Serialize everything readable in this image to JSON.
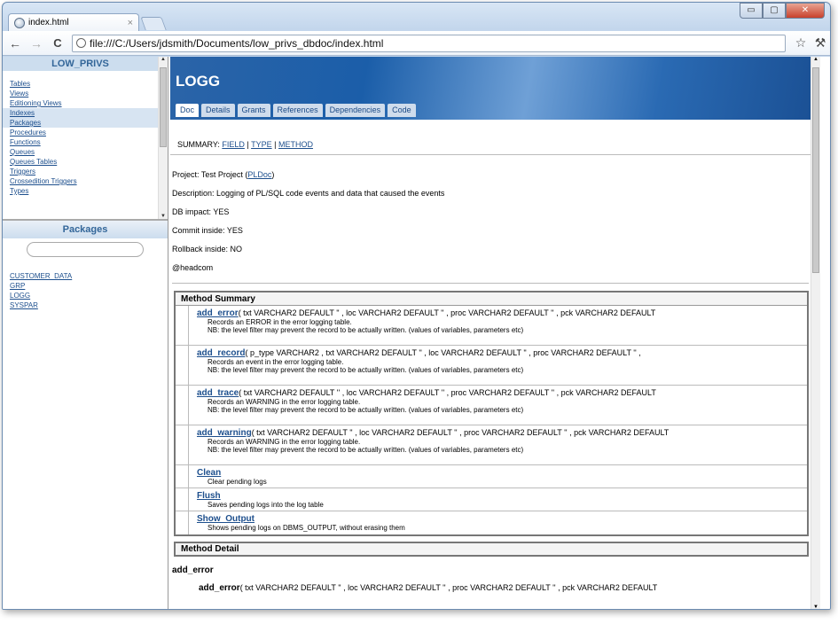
{
  "browser": {
    "tab_title": "index.html",
    "tab_close": "×",
    "url": "file:///C:/Users/jdsmith/Documents/low_privs_dbdoc/index.html",
    "back": "←",
    "forward": "→",
    "reload": "C",
    "star": "☆",
    "wrench": "🔧",
    "win_min": "▭",
    "win_max": "▢",
    "win_close": "✕"
  },
  "sidebar": {
    "title": "LOW_PRIVS",
    "items": [
      {
        "label": "Tables",
        "selected": false
      },
      {
        "label": "Views",
        "selected": false
      },
      {
        "label": "Editioning Views",
        "selected": false
      },
      {
        "label": "Indexes",
        "selected": true
      },
      {
        "label": "Packages",
        "selected": true
      },
      {
        "label": "Procedures",
        "selected": false
      },
      {
        "label": "Functions",
        "selected": false
      },
      {
        "label": "Queues",
        "selected": false
      },
      {
        "label": "Queues Tables",
        "selected": false
      },
      {
        "label": "Triggers",
        "selected": false
      },
      {
        "label": "Crossedition Triggers",
        "selected": false
      },
      {
        "label": "Types",
        "selected": false
      }
    ],
    "packages_title": "Packages",
    "packages": [
      "CUSTOMER_DATA",
      "GRP",
      "LOGG",
      "SYSPAR"
    ]
  },
  "doc": {
    "title": "LOGG",
    "tabs": [
      "Doc",
      "Details",
      "Grants",
      "References",
      "Dependencies",
      "Code"
    ],
    "summary_label": "SUMMARY:",
    "summary_links": [
      "FIELD",
      "TYPE",
      "METHOD"
    ],
    "summary_sep": "|",
    "project_label": "Project: Test Project (",
    "project_link": "PLDoc",
    "project_close": ")",
    "description": "Description: Logging of PL/SQL code events and data that caused the events",
    "db_impact": "DB impact: YES",
    "commit_inside": "Commit inside: YES",
    "rollback_inside": "Rollback inside: NO",
    "headcom": "@headcom",
    "method_summary_title": "Method Summary",
    "methods": [
      {
        "name": "add_error",
        "params": "( txt VARCHAR2 DEFAULT '' , loc VARCHAR2 DEFAULT '' , proc VARCHAR2 DEFAULT '' , pck VARCHAR2 DEFAULT",
        "desc1": "Records an ERROR in the error logging table.",
        "desc2": "NB: the level filter may prevent the record to be actually written. (values of variables, parameters etc)"
      },
      {
        "name": "add_record",
        "params": "( p_type VARCHAR2 , txt VARCHAR2 DEFAULT '' , loc VARCHAR2 DEFAULT '' , proc VARCHAR2 DEFAULT '' ,",
        "desc1": "Records an event in the error logging table.",
        "desc2": "NB: the level filter may prevent the record to be actually written. (values of variables, parameters etc)"
      },
      {
        "name": "add_trace",
        "params": "( txt VARCHAR2 DEFAULT '' , loc VARCHAR2 DEFAULT '' , proc VARCHAR2 DEFAULT '' , pck VARCHAR2 DEFAULT",
        "desc1": "Records an WARNING in the error logging table.",
        "desc2": "NB: the level filter may prevent the record to be actually written. (values of variables, parameters etc)"
      },
      {
        "name": "add_warning",
        "params": "( txt VARCHAR2 DEFAULT '' , loc VARCHAR2 DEFAULT '' , proc VARCHAR2 DEFAULT '' , pck VARCHAR2 DEFAULT",
        "desc1": "Records an WARNING in the error logging table.",
        "desc2": "NB: the level filter may prevent the record to be actually written. (values of variables, parameters etc)"
      },
      {
        "name": "Clean",
        "params": "",
        "desc1": "Clear pending logs",
        "desc2": ""
      },
      {
        "name": "Flush",
        "params": "",
        "desc1": "Saves pending logs into the log table",
        "desc2": ""
      },
      {
        "name": "Show_Output",
        "params": "",
        "desc1": "Shows pending logs on DBMS_OUTPUT, without erasing them",
        "desc2": ""
      }
    ],
    "method_detail_title": "Method Detail",
    "detail_name": "add_error",
    "detail_sig_name": "add_error",
    "detail_sig_params": "( txt VARCHAR2 DEFAULT '' , loc VARCHAR2 DEFAULT '' , proc VARCHAR2 DEFAULT '' , pck VARCHAR2 DEFAULT"
  }
}
